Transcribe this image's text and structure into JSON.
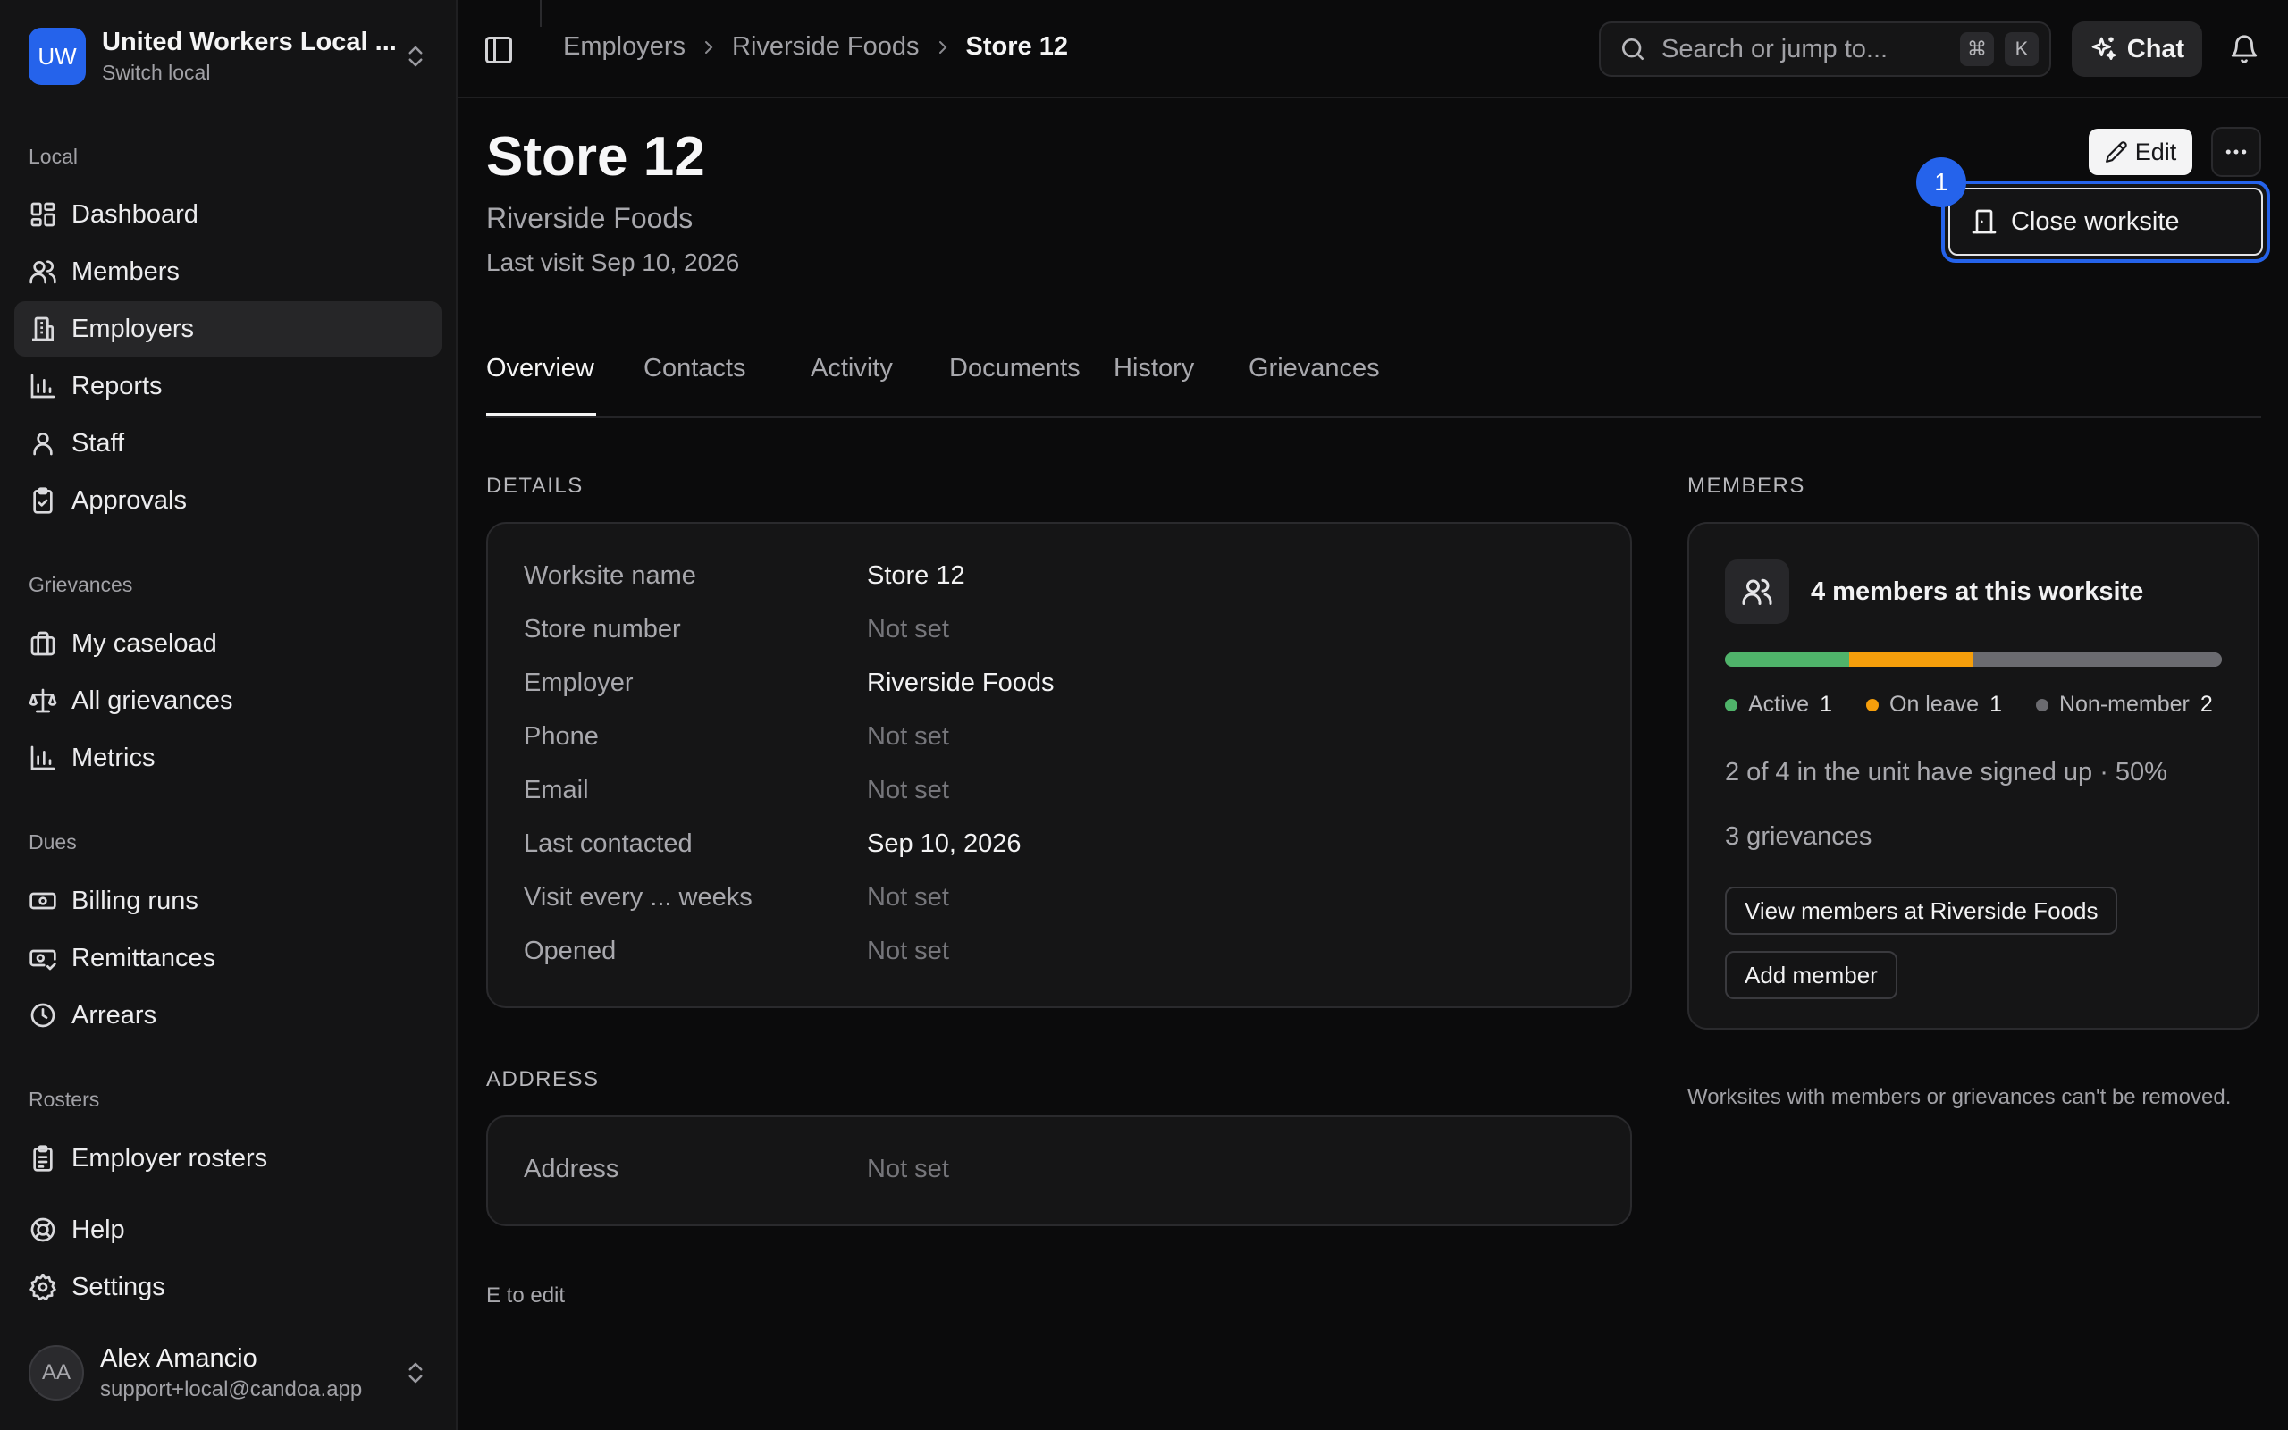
{
  "org": {
    "initials": "UW",
    "name": "United Workers Local ...",
    "subtitle": "Switch local"
  },
  "sidebar": {
    "sections": [
      {
        "label": "Local",
        "items": [
          {
            "label": "Dashboard",
            "icon": "dashboard-icon"
          },
          {
            "label": "Members",
            "icon": "users-icon"
          },
          {
            "label": "Employers",
            "icon": "building-icon",
            "active": true
          },
          {
            "label": "Reports",
            "icon": "bar-chart-icon"
          },
          {
            "label": "Staff",
            "icon": "user-icon"
          },
          {
            "label": "Approvals",
            "icon": "clipboard-check-icon"
          }
        ]
      },
      {
        "label": "Grievances",
        "items": [
          {
            "label": "My caseload",
            "icon": "briefcase-icon"
          },
          {
            "label": "All grievances",
            "icon": "scale-icon"
          },
          {
            "label": "Metrics",
            "icon": "bar-chart-icon"
          }
        ]
      },
      {
        "label": "Dues",
        "items": [
          {
            "label": "Billing runs",
            "icon": "banknote-icon"
          },
          {
            "label": "Remittances",
            "icon": "banknote-check-icon"
          },
          {
            "label": "Arrears",
            "icon": "clock-icon"
          }
        ]
      },
      {
        "label": "Rosters",
        "items": [
          {
            "label": "Employer rosters",
            "icon": "clipboard-list-icon"
          }
        ]
      }
    ],
    "help": "Help",
    "settings": "Settings"
  },
  "user": {
    "initials": "AA",
    "name": "Alex Amancio",
    "email": "support+local@candoa.app"
  },
  "breadcrumb": [
    "Employers",
    "Riverside Foods",
    "Store 12"
  ],
  "search": {
    "placeholder": "Search or jump to...",
    "shortcut_mod": "⌘",
    "shortcut_key": "K"
  },
  "chat": {
    "label": "Chat"
  },
  "page": {
    "title": "Store 12",
    "subtitle": "Riverside Foods",
    "meta": "Last visit Sep 10, 2026"
  },
  "actions": {
    "edit": "Edit",
    "menu_item": "Close worksite",
    "step_badge": "1"
  },
  "tabs": [
    "Overview",
    "Contacts",
    "Activity",
    "Documents",
    "History",
    "Grievances"
  ],
  "active_tab": "Overview",
  "details": {
    "heading": "DETAILS",
    "rows": [
      {
        "label": "Worksite name",
        "value": "Store 12",
        "set": true
      },
      {
        "label": "Store number",
        "value": "Not set",
        "set": false
      },
      {
        "label": "Employer",
        "value": "Riverside Foods",
        "set": true
      },
      {
        "label": "Phone",
        "value": "Not set",
        "set": false
      },
      {
        "label": "Email",
        "value": "Not set",
        "set": false
      },
      {
        "label": "Last contacted",
        "value": "Sep 10, 2026",
        "set": true
      },
      {
        "label": "Visit every ... weeks",
        "value": "Not set",
        "set": false
      },
      {
        "label": "Opened",
        "value": "Not set",
        "set": false
      }
    ]
  },
  "address": {
    "heading": "ADDRESS",
    "label": "Address",
    "value": "Not set"
  },
  "members": {
    "heading": "MEMBERS",
    "title": "4 members at this worksite",
    "total": 4,
    "breakdown": [
      {
        "label": "Active",
        "count": 1,
        "color": "#4fb36a"
      },
      {
        "label": "On leave",
        "count": 1,
        "color": "#f59e0b"
      },
      {
        "label": "Non-member",
        "count": 2,
        "color": "#6b6b70"
      }
    ],
    "signup_text": "2 of 4 in the unit have signed up · 50%",
    "grievances_text": "3 grievances",
    "view_button": "View members at Riverside Foods",
    "add_button": "Add member"
  },
  "footnote": "Worksites with members or grievances can't be removed.",
  "edit_hint": "E to edit",
  "colors": {
    "accent": "#2563eb",
    "background": "#0b0b0c",
    "sidebar": "#141415"
  }
}
